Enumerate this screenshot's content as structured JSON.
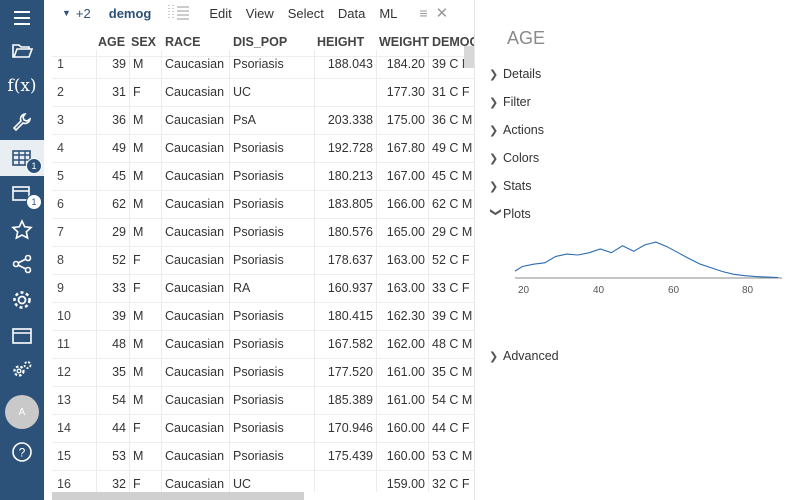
{
  "sidebar": {
    "items": [
      {
        "name": "menu-icon"
      },
      {
        "name": "folder-open-icon"
      },
      {
        "name": "function-icon",
        "label": "f(x)"
      },
      {
        "name": "wrench-icon"
      },
      {
        "name": "table-icon",
        "badge": "1",
        "active": true
      },
      {
        "name": "windows-icon",
        "badge": "1"
      },
      {
        "name": "star-icon"
      },
      {
        "name": "share-icon"
      },
      {
        "name": "gear-settings-icon"
      },
      {
        "name": "window-icon"
      },
      {
        "name": "gears-icon"
      },
      {
        "name": "avatar",
        "label": "A"
      },
      {
        "name": "help-icon",
        "label": "?"
      }
    ]
  },
  "toolbar": {
    "views_count": "+2",
    "table_name": "demog",
    "menu": [
      "Edit",
      "View",
      "Select",
      "Data",
      "ML"
    ]
  },
  "table": {
    "columns": [
      "AGE",
      "SEX",
      "RACE",
      "DIS_POP",
      "HEIGHT",
      "WEIGHT",
      "DEMOG"
    ],
    "rows": [
      [
        "1",
        "39",
        "M",
        "Caucasian",
        "Psoriasis",
        "188.043",
        "184.20",
        "39 C M"
      ],
      [
        "2",
        "31",
        "F",
        "Caucasian",
        "UC",
        "",
        "177.30",
        "31 C F"
      ],
      [
        "3",
        "36",
        "M",
        "Caucasian",
        "PsA",
        "203.338",
        "175.00",
        "36 C M"
      ],
      [
        "4",
        "49",
        "M",
        "Caucasian",
        "Psoriasis",
        "192.728",
        "167.80",
        "49 C M"
      ],
      [
        "5",
        "45",
        "M",
        "Caucasian",
        "Psoriasis",
        "180.213",
        "167.00",
        "45 C M"
      ],
      [
        "6",
        "62",
        "M",
        "Caucasian",
        "Psoriasis",
        "183.805",
        "166.00",
        "62 C M"
      ],
      [
        "7",
        "29",
        "M",
        "Caucasian",
        "Psoriasis",
        "180.576",
        "165.00",
        "29 C M"
      ],
      [
        "8",
        "52",
        "F",
        "Caucasian",
        "Psoriasis",
        "178.637",
        "163.00",
        "52 C F"
      ],
      [
        "9",
        "33",
        "F",
        "Caucasian",
        "RA",
        "160.937",
        "163.00",
        "33 C F"
      ],
      [
        "10",
        "39",
        "M",
        "Caucasian",
        "Psoriasis",
        "180.415",
        "162.30",
        "39 C M"
      ],
      [
        "11",
        "48",
        "M",
        "Caucasian",
        "Psoriasis",
        "167.582",
        "162.00",
        "48 C M"
      ],
      [
        "12",
        "35",
        "M",
        "Caucasian",
        "Psoriasis",
        "177.520",
        "161.00",
        "35 C M"
      ],
      [
        "13",
        "54",
        "M",
        "Caucasian",
        "Psoriasis",
        "185.389",
        "161.00",
        "54 C M"
      ],
      [
        "14",
        "44",
        "F",
        "Caucasian",
        "Psoriasis",
        "170.946",
        "160.00",
        "44 C F"
      ],
      [
        "15",
        "53",
        "M",
        "Caucasian",
        "Psoriasis",
        "175.439",
        "160.00",
        "53 C M"
      ],
      [
        "16",
        "32",
        "F",
        "Caucasian",
        "UC",
        "",
        "159.00",
        "32 C F"
      ]
    ]
  },
  "properties": {
    "title": "AGE",
    "sections": [
      {
        "label": "Details",
        "expanded": false
      },
      {
        "label": "Filter",
        "expanded": false
      },
      {
        "label": "Actions",
        "expanded": false
      },
      {
        "label": "Colors",
        "expanded": false
      },
      {
        "label": "Stats",
        "expanded": false
      },
      {
        "label": "Plots",
        "expanded": true
      }
    ],
    "advanced_label": "Advanced"
  },
  "chart_data": {
    "type": "line",
    "title": "",
    "xlabel": "",
    "ylabel": "",
    "xlim": [
      18,
      90
    ],
    "x_ticks": [
      "20",
      "40",
      "60",
      "80"
    ],
    "x": [
      18,
      20,
      23,
      26,
      29,
      32,
      35,
      38,
      41,
      44,
      47,
      50,
      53,
      56,
      59,
      62,
      65,
      68,
      71,
      74,
      77,
      80,
      83,
      86,
      89
    ],
    "values": [
      0.15,
      0.25,
      0.3,
      0.33,
      0.47,
      0.52,
      0.5,
      0.55,
      0.63,
      0.55,
      0.7,
      0.58,
      0.72,
      0.78,
      0.68,
      0.55,
      0.42,
      0.3,
      0.22,
      0.14,
      0.08,
      0.05,
      0.03,
      0.02,
      0.01
    ],
    "line_color": "#2b6cb0",
    "grid": false
  }
}
